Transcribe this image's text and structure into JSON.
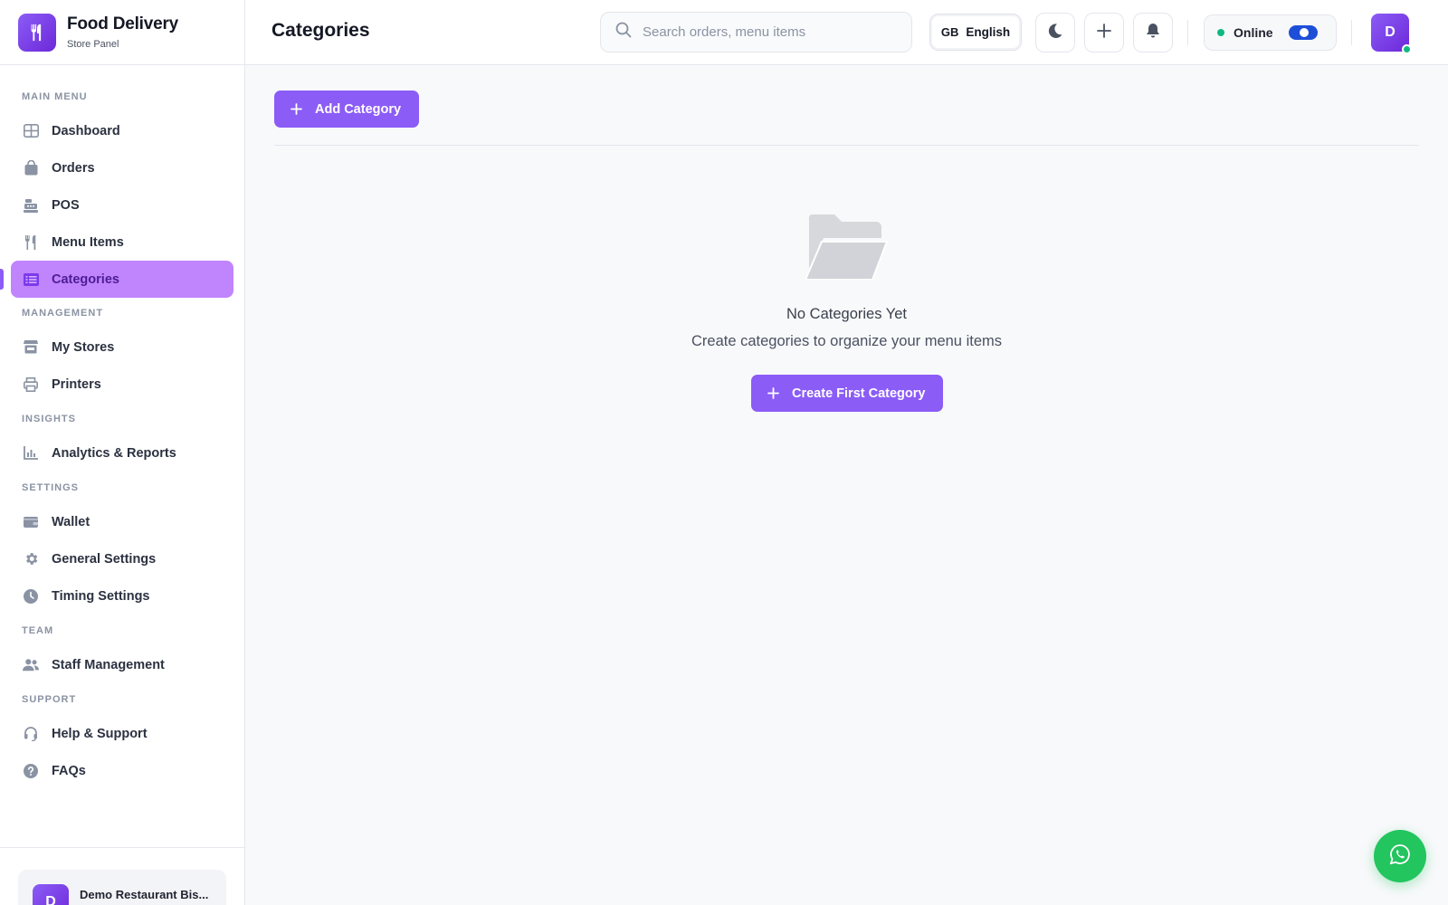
{
  "brand": {
    "title": "Food Delivery",
    "subtitle": "Store Panel",
    "logo_icon": "utensils-icon"
  },
  "sidebar": {
    "sections": [
      {
        "label": "MAIN MENU",
        "items": [
          {
            "label": "Dashboard",
            "icon": "dashboard-icon"
          },
          {
            "label": "Orders",
            "icon": "shopping-bag-icon"
          },
          {
            "label": "POS",
            "icon": "cash-register-icon"
          },
          {
            "label": "Menu Items",
            "icon": "utensils-icon"
          },
          {
            "label": "Categories",
            "icon": "list-icon",
            "active": true
          }
        ]
      },
      {
        "label": "MANAGEMENT",
        "items": [
          {
            "label": "My Stores",
            "icon": "store-icon"
          },
          {
            "label": "Printers",
            "icon": "printer-icon"
          }
        ]
      },
      {
        "label": "INSIGHTS",
        "items": [
          {
            "label": "Analytics & Reports",
            "icon": "chart-icon"
          }
        ]
      },
      {
        "label": "SETTINGS",
        "items": [
          {
            "label": "Wallet",
            "icon": "wallet-icon"
          },
          {
            "label": "General Settings",
            "icon": "gear-icon"
          },
          {
            "label": "Timing Settings",
            "icon": "clock-icon"
          }
        ]
      },
      {
        "label": "TEAM",
        "items": [
          {
            "label": "Staff Management",
            "icon": "users-icon"
          }
        ]
      },
      {
        "label": "SUPPORT",
        "items": [
          {
            "label": "Help & Support",
            "icon": "headset-icon"
          },
          {
            "label": "FAQs",
            "icon": "question-circle-icon"
          }
        ]
      }
    ],
    "store": {
      "avatar_letter": "D",
      "name": "Demo Restaurant Bis..."
    }
  },
  "header": {
    "title": "Categories",
    "search": {
      "placeholder": "Search orders, menu items",
      "value": ""
    },
    "language": {
      "code": "GB",
      "name": "English"
    },
    "status": {
      "label": "Online",
      "enabled": true
    },
    "user_avatar_letter": "D"
  },
  "main": {
    "add_button_label": "Add Category",
    "empty_state": {
      "icon": "folder-open-icon",
      "title": "No Categories Yet",
      "subtitle": "Create categories to organize your menu items",
      "cta_label": "Create First Category"
    }
  },
  "colors": {
    "accent": "#8b5cf6",
    "active_bg": "#c084fc",
    "online": "#10b981",
    "whatsapp": "#22c55e"
  }
}
